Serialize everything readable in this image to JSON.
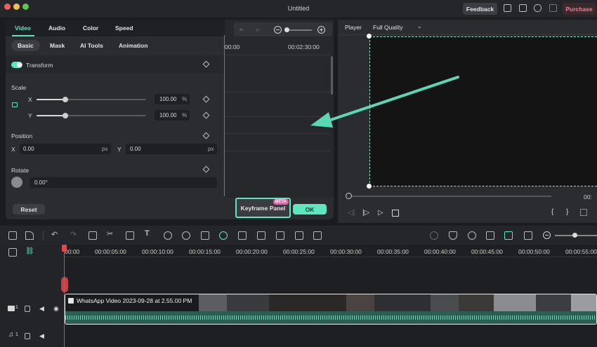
{
  "window": {
    "title": "Untitled",
    "feedback": "Feedback",
    "purchase": "Purchase"
  },
  "properties": {
    "tabs": [
      "Video",
      "Audio",
      "Color",
      "Speed"
    ],
    "subtabs": [
      "Basic",
      "Mask",
      "AI Tools",
      "Animation"
    ],
    "transform_label": "Transform",
    "scale_label": "Scale",
    "scale_x_label": "X",
    "scale_y_label": "Y",
    "scale_x_value": "100.00",
    "scale_y_value": "100.00",
    "percent": "%",
    "position_label": "Position",
    "pos_x_label": "X",
    "pos_x_value": "0.00",
    "pos_y_label": "Y",
    "pos_y_value": "0.00",
    "px": "px",
    "rotate_label": "Rotate",
    "rotate_value": "0.00°",
    "reset": "Reset",
    "keyframe_panel": "Keyframe Panel",
    "beta": "BETA",
    "ok": "OK"
  },
  "keyframe": {
    "time_start": "00:00",
    "time_end": "00:02:30:00"
  },
  "player": {
    "label": "Player",
    "quality": "Full Quality",
    "time_partial": "00:"
  },
  "timeline": {
    "ruler": [
      "00:00",
      "00:00:05:00",
      "00:00:10:00",
      "00:00:15:00",
      "00:00:20:00",
      "00:00:25:00",
      "00:00:30:00",
      "00:00:35:00",
      "00:00:40:00",
      "00:00:45:00",
      "00:00:50:00",
      "00:00:55:00"
    ],
    "video_track_num": "1",
    "audio_track_num": "1",
    "clip_name": "WhatsApp Video 2023-09-28 at 2.55.00 PM"
  },
  "colors": {
    "accent": "#5ee6c0",
    "purchase_bg": "#3a2a2e",
    "purchase_text": "#f27da0",
    "playhead": "#e0484d",
    "annotation_arrow": "#5ad8b4"
  }
}
